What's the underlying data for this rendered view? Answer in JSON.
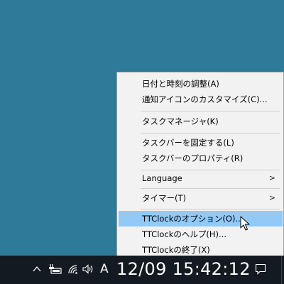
{
  "context_menu": {
    "items": [
      {
        "label": "日付と時刻の調整(A)"
      },
      {
        "label": "通知アイコンのカスタマイズ(C)..."
      },
      {
        "label": "タスクマネージャ(K)"
      },
      {
        "label": "タスクバーを固定する(L)"
      },
      {
        "label": "タスクバーのプロパティ(R)"
      },
      {
        "label": "Language",
        "submenu_arrow": ">"
      },
      {
        "label": "タイマー(T)",
        "submenu_arrow": ">"
      },
      {
        "label": "TTClockのオプション(O)...",
        "highlighted": true
      },
      {
        "label": "TTClockのヘルプ(H)..."
      },
      {
        "label": "TTClockの終了(X)"
      }
    ]
  },
  "taskbar": {
    "tray_icons": [
      "chevron-up-icon",
      "battery-icon",
      "wifi-icon",
      "speaker-icon"
    ],
    "ime_indicator": "A",
    "clock": "12/09 15:42:12",
    "notification_icon": "action-center-icon"
  },
  "colors": {
    "desktop": "#2d7b98",
    "taskbar": "#131a21",
    "menu_bg": "#f2f2f2",
    "highlight": "#91c9f7"
  }
}
